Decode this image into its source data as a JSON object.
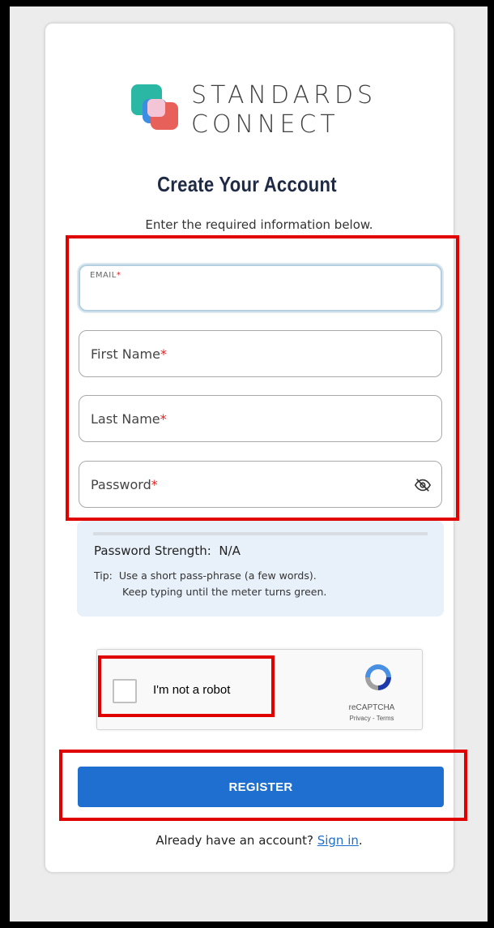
{
  "brand": {
    "line1": "STANDARDS",
    "line2": "CONNECT"
  },
  "page": {
    "title": "Create Your Account",
    "subtitle": "Enter the required information below."
  },
  "form": {
    "email": {
      "label": "EMAIL",
      "required_mark": "*",
      "value": ""
    },
    "first_name": {
      "label": "First Name",
      "required_mark": "*",
      "value": ""
    },
    "last_name": {
      "label": "Last Name",
      "required_mark": "*",
      "value": ""
    },
    "password": {
      "label": "Password",
      "required_mark": "*",
      "value": "",
      "toggle_icon": "eye-off-icon"
    }
  },
  "password_strength": {
    "label": "Password Strength:",
    "value": "N/A",
    "tip_prefix": "Tip:",
    "tip_line1": "Use a short pass-phrase (a few words).",
    "tip_line2": "Keep typing until the meter turns green."
  },
  "recaptcha": {
    "checkbox_label": "I'm not a robot",
    "brand": "reCAPTCHA",
    "links": "Privacy - Terms"
  },
  "actions": {
    "register_label": "REGISTER",
    "signin_prompt": "Already have an account?",
    "signin_link": "Sign in",
    "signin_suffix": "."
  },
  "colors": {
    "primary_button": "#1e6fd0",
    "highlight_border": "#e00000",
    "required_mark": "#e02020",
    "strength_panel": "#e8f1fa"
  }
}
